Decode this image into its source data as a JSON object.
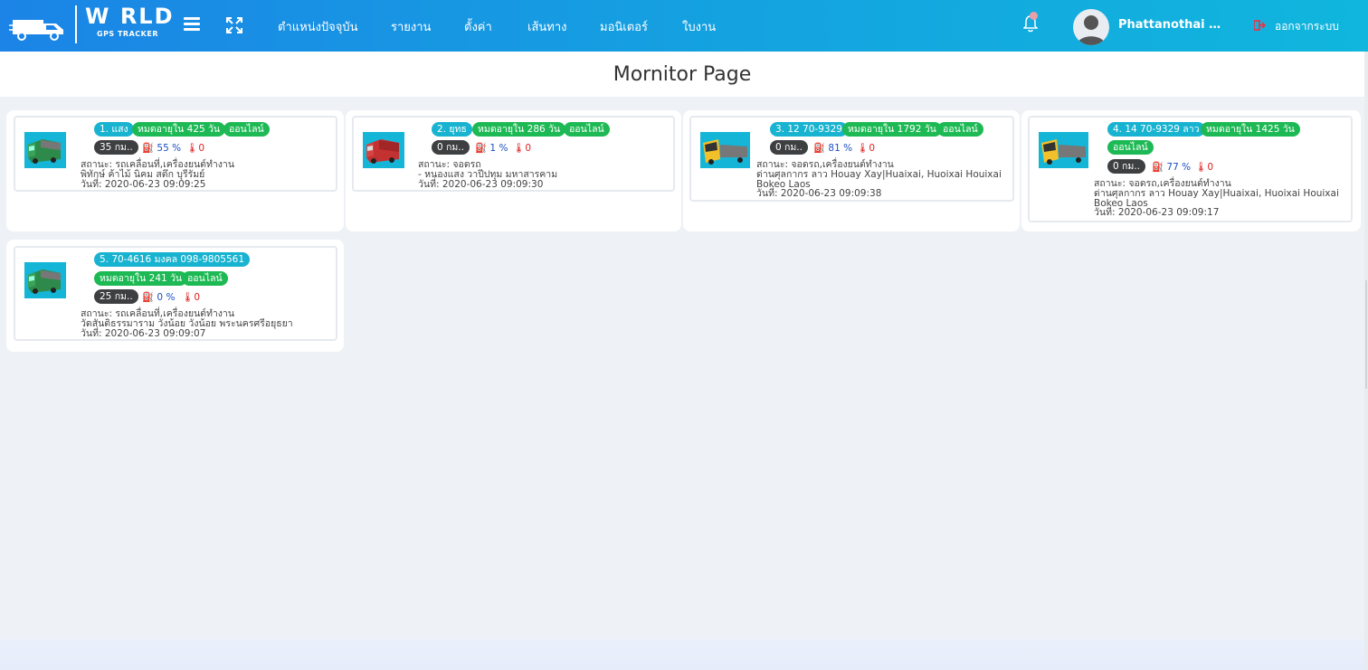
{
  "header": {
    "logo_text": "W RLD",
    "logo_sub": "GPS TRACKER",
    "nav": [
      "ตำแหน่งปัจจุบัน",
      "รายงาน",
      "ตั้งค่า",
      "เส้นทาง",
      "มอนิเตอร์",
      "ใบงาน"
    ],
    "username": "Phattanothai Puk...",
    "logout_label": "ออกจากระบบ"
  },
  "page": {
    "title": "Mornitor Page"
  },
  "vehicles": [
    {
      "title": "1. แสง",
      "expiry": "หมดอายุใน 425 วัน",
      "online": "ออนไลน์",
      "speed": "35 กม..",
      "fuel": "55 %",
      "temp": "0",
      "status": "สถานะ: รถเคลื่อนที่,เครื่องยนต์ทำงาน",
      "location": "พิทักษ์ ค้าไม้ นิคม สตึก บุรีรัมย์",
      "date": "วันที่: 2020-06-23 09:09:25",
      "color": "green"
    },
    {
      "title": "2. ยุทธ",
      "expiry": "หมดอายุใน 286 วัน",
      "online": "ออนไลน์",
      "speed": "0 กม..",
      "fuel": "1 %",
      "temp": "0",
      "status": "สถานะ: จอดรถ",
      "location": "- หนองแสง วาปีปทุม มหาสารคาม",
      "date": "วันที่: 2020-06-23 09:09:30",
      "color": "red"
    },
    {
      "title": "3. 12 70-9329",
      "expiry": "หมดอายุใน 1792 วัน",
      "online": "ออนไลน์",
      "speed": "0 กม..",
      "fuel": "81 %",
      "temp": "0",
      "status": "สถานะ: จอดรถ,เครื่องยนต์ทำงาน",
      "location": "ด่านศุลกากร ลาว Houay Xay|Huaixai, Huoixai Houixai",
      "location2": "Bokeo Laos",
      "date": "วันที่: 2020-06-23 09:09:38",
      "color": "yellow"
    },
    {
      "title": "4. 14 70-9329 ลาว",
      "expiry": "หมดอายุใน 1425 วัน",
      "online": "ออนไลน์",
      "speed": "0 กม..",
      "fuel": "77 %",
      "temp": "0",
      "status": "สถานะ: จอดรถ,เครื่องยนต์ทำงาน",
      "location": "ด่านศุลกากร ลาว Houay Xay|Huaixai, Huoixai Houixai",
      "location2": "Bokeo Laos",
      "date": "วันที่: 2020-06-23 09:09:17",
      "color": "yellow"
    },
    {
      "title": "5. 70-4616 มงคล 098-9805561",
      "expiry": "หมดอายุใน 241 วัน",
      "online": "ออนไลน์",
      "speed": "25 กม..",
      "fuel": "0 %",
      "temp": "0",
      "status": "สถานะ: รถเคลื่อนที่,เครื่องยนต์ทำงาน",
      "location": "วัดสันติธรรมาราม วังน้อย วังน้อย พระนครศรีอยุธยา",
      "date": "วันที่: 2020-06-23 09:09:07",
      "color": "green"
    }
  ]
}
